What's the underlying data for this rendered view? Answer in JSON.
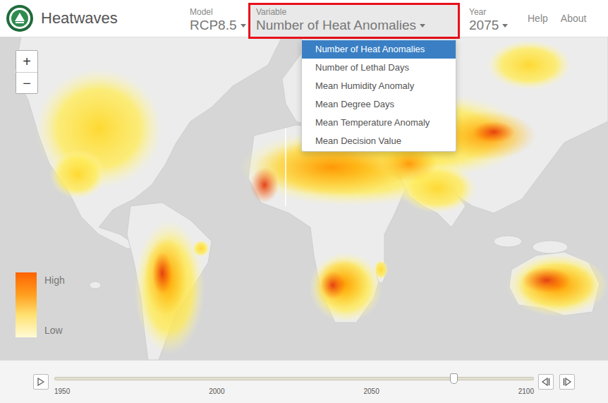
{
  "header": {
    "title": "Heatwaves",
    "links": [
      "Help",
      "About"
    ]
  },
  "selectors": [
    {
      "label": "Model",
      "value": "RCP8.5",
      "highlighted": false,
      "open": false
    },
    {
      "label": "Variable",
      "value": "Number of Heat Anomalies",
      "highlighted": true,
      "open": true
    },
    {
      "label": "Year",
      "value": "2075",
      "highlighted": false,
      "open": false
    }
  ],
  "variable_menu": [
    {
      "label": "Number of Heat Anomalies",
      "selected": true
    },
    {
      "label": "Number of Lethal Days",
      "selected": false
    },
    {
      "label": "Mean Humidity Anomaly",
      "selected": false
    },
    {
      "label": "Mean Degree Days",
      "selected": false
    },
    {
      "label": "Mean Temperature Anomaly",
      "selected": false
    },
    {
      "label": "Mean Decision Value",
      "selected": false
    }
  ],
  "zoom": [
    "+",
    "−"
  ],
  "legend": {
    "high": "High",
    "low": "Low"
  },
  "timeline": {
    "ticks": [
      "1950",
      "2000",
      "2050",
      "2100"
    ],
    "level": 0.833
  }
}
